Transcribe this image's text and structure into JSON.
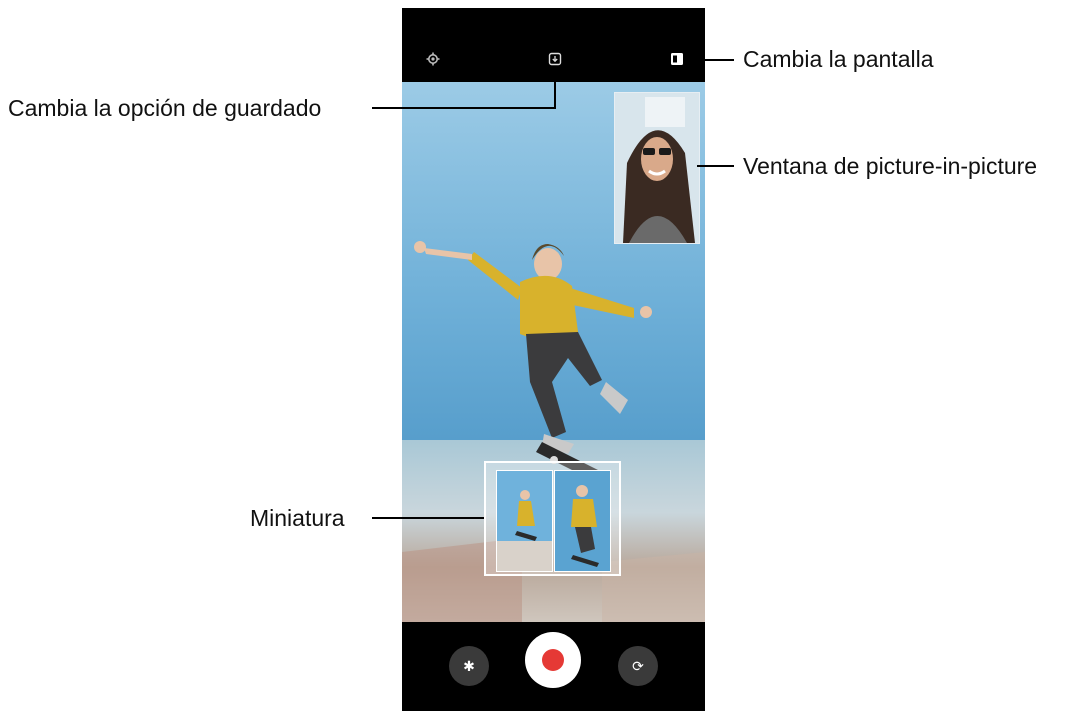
{
  "callouts": {
    "change_screen": "Cambia la pantalla",
    "save_option": "Cambia la opción de guardado",
    "pip_window": "Ventana de picture-in-picture",
    "thumbnail": "Miniatura"
  },
  "icons": {
    "settings": "gear-icon",
    "save_option": "save-option-icon",
    "switch_view": "screen-switch-icon",
    "effects": "effects-icon",
    "record": "record-button",
    "flip": "switch-camera-icon"
  },
  "colors": {
    "record": "#e53935",
    "bars": "#000000",
    "callout_text": "#111111"
  }
}
